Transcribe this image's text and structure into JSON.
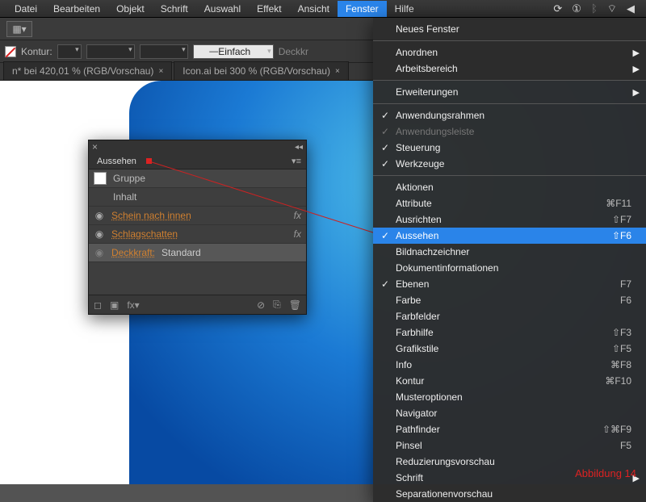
{
  "menubar": {
    "items": [
      "Datei",
      "Bearbeiten",
      "Objekt",
      "Schrift",
      "Auswahl",
      "Effekt",
      "Ansicht",
      "Fenster",
      "Hilfe"
    ],
    "activeIndex": 7
  },
  "optbar": {
    "kontur": "Kontur:",
    "stroke": "Einfach",
    "deckkr": "Deckkr"
  },
  "tabs": [
    {
      "label": "n* bei 420,01 % (RGB/Vorschau)"
    },
    {
      "label": "Icon.ai bei 300 % (RGB/Vorschau)"
    }
  ],
  "panel": {
    "title": "Aussehen",
    "head": {
      "label": "Gruppe"
    },
    "inhalt": "Inhalt",
    "rows": [
      {
        "label": "Schein nach innen",
        "fx": true
      },
      {
        "label": "Schlagschatten",
        "fx": true
      }
    ],
    "opacity": {
      "label": "Deckkraft:",
      "value": "Standard"
    }
  },
  "dropdown": {
    "top": [
      {
        "label": "Neues Fenster"
      }
    ],
    "sec2": [
      {
        "label": "Anordnen",
        "arrow": true
      },
      {
        "label": "Arbeitsbereich",
        "arrow": true
      }
    ],
    "sec3": [
      {
        "label": "Erweiterungen",
        "arrow": true
      }
    ],
    "sec4": [
      {
        "label": "Anwendungsrahmen",
        "check": true
      },
      {
        "label": "Anwendungsleiste",
        "check": true,
        "disabled": true
      },
      {
        "label": "Steuerung",
        "check": true
      },
      {
        "label": "Werkzeuge",
        "check": true
      }
    ],
    "sec5": [
      {
        "label": "Aktionen"
      },
      {
        "label": "Attribute",
        "shortcut": "⌘F11"
      },
      {
        "label": "Ausrichten",
        "shortcut": "⇧F7"
      },
      {
        "label": "Aussehen",
        "shortcut": "⇧F6",
        "check": true,
        "selected": true
      },
      {
        "label": "Bildnachzeichner"
      },
      {
        "label": "Dokumentinformationen"
      },
      {
        "label": "Ebenen",
        "shortcut": "F7",
        "check": true
      },
      {
        "label": "Farbe",
        "shortcut": "F6"
      },
      {
        "label": "Farbfelder"
      },
      {
        "label": "Farbhilfe",
        "shortcut": "⇧F3"
      },
      {
        "label": "Grafikstile",
        "shortcut": "⇧F5"
      },
      {
        "label": "Info",
        "shortcut": "⌘F8"
      },
      {
        "label": "Kontur",
        "shortcut": "⌘F10"
      },
      {
        "label": "Musteroptionen"
      },
      {
        "label": "Navigator"
      },
      {
        "label": "Pathfinder",
        "shortcut": "⇧⌘F9"
      },
      {
        "label": "Pinsel",
        "shortcut": "F5"
      },
      {
        "label": "Reduzierungsvorschau"
      },
      {
        "label": "Schrift",
        "arrow": true
      },
      {
        "label": "Separationenvorschau"
      }
    ]
  },
  "figure": "Abbildung  14",
  "chart_data": null
}
